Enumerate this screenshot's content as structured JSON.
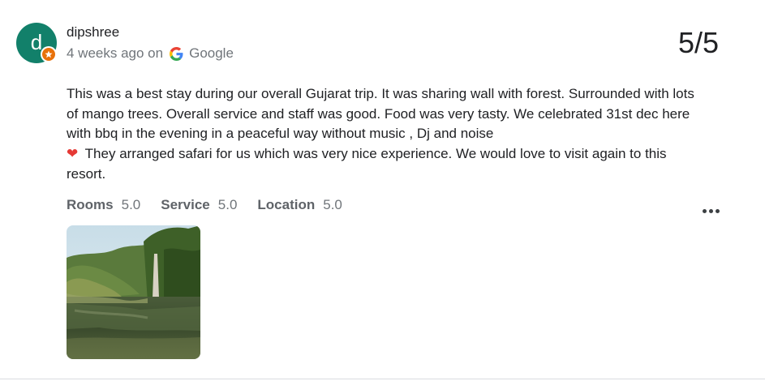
{
  "review": {
    "avatar_letter": "d",
    "author": "dipshree",
    "time_ago": "4 weeks ago on",
    "source": "Google",
    "score": "5/5",
    "text_before_heart": "This was a best stay during our overall Gujarat trip. It was sharing wall with forest. Surrounded with lots of mango trees. Overall service and staff was good. Food was very tasty. We celebrated 31st dec here with bbq in the evening in a peaceful way without music , Dj and noise",
    "heart": "❤",
    "text_after_heart": "They arranged safari for us which was very nice experience. We would love to visit again to this resort.",
    "ratings": [
      {
        "label": "Rooms",
        "value": "5.0"
      },
      {
        "label": "Service",
        "value": "5.0"
      },
      {
        "label": "Location",
        "value": "5.0"
      }
    ]
  },
  "colors": {
    "avatar": "#12806a",
    "badge": "#e8710a",
    "heart": "#e53935"
  },
  "icons": {
    "badge": "local-guide-star-icon",
    "source": "google-g-logo-icon",
    "more": "more-horizontal-icon"
  }
}
